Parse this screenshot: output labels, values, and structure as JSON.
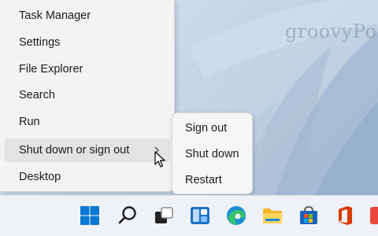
{
  "watermark": "groovyPost",
  "quick_link_menu": {
    "items": [
      {
        "label": "Task Manager"
      },
      {
        "label": "Settings"
      },
      {
        "label": "File Explorer"
      },
      {
        "label": "Search"
      },
      {
        "label": "Run"
      },
      {
        "label": "Shut down or sign out",
        "has_submenu": true,
        "highlighted": true
      },
      {
        "label": "Desktop"
      }
    ]
  },
  "shutdown_submenu": {
    "items": [
      {
        "label": "Sign out"
      },
      {
        "label": "Shut down"
      },
      {
        "label": "Restart"
      }
    ]
  },
  "taskbar": {
    "icons": [
      "windows-start-icon",
      "search-icon",
      "task-view-icon",
      "widgets-icon",
      "edge-browser-icon",
      "file-explorer-icon",
      "microsoft-store-icon",
      "office-icon",
      "app-icon"
    ]
  },
  "colors": {
    "accent_blue": "#0067c0",
    "menu_bg": "#f3f3f3",
    "highlight": "#e3e3e3"
  }
}
